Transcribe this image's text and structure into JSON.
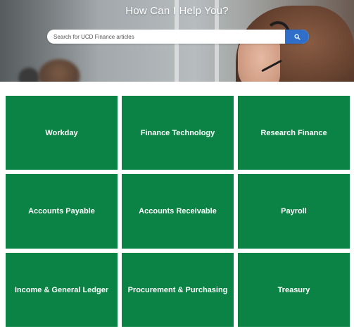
{
  "hero": {
    "title": "How Can I Help You?",
    "search_placeholder": "Search for UCD Finance articles",
    "search_icon": "search-icon",
    "search_button_color": "#2f6fc9"
  },
  "tiles": [
    {
      "label": "Workday"
    },
    {
      "label": "Finance Technology"
    },
    {
      "label": "Research Finance"
    },
    {
      "label": "Accounts Payable"
    },
    {
      "label": "Accounts Receivable"
    },
    {
      "label": "Payroll"
    },
    {
      "label": "Income & General Ledger"
    },
    {
      "label": "Procurement & Purchasing"
    },
    {
      "label": "Treasury"
    }
  ],
  "colors": {
    "tile_green": "#0a8345",
    "accent_blue": "#2f6fc9"
  }
}
